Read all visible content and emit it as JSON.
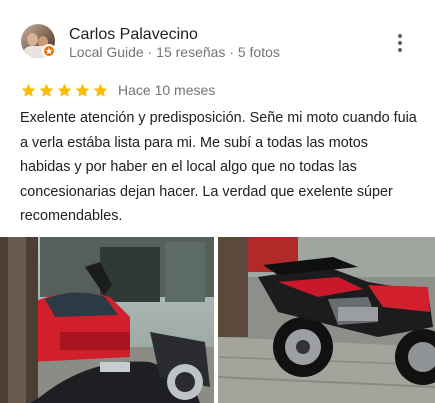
{
  "reviewer": {
    "name": "Carlos Palavecino",
    "meta": "Local Guide · 15 reseñas · 5 fotos"
  },
  "review": {
    "rating": 5,
    "rating_max": 5,
    "time": "Hace 10 meses",
    "text": "Exelente atención y predisposición. Señe mi moto cuando fuia a verla estába lista para mi. Me subí a todas las motos habidas y por haber en el local algo que no todas las concesionarias dejan hacer. La verdad que exelente súper recomendables."
  },
  "icons": {
    "more": "more-vert-icon",
    "star": "star-icon",
    "badge": "local-guide-badge-icon"
  },
  "colors": {
    "star": "#fbbc04",
    "badge": "#e8710a",
    "meta_text": "#70757a"
  }
}
